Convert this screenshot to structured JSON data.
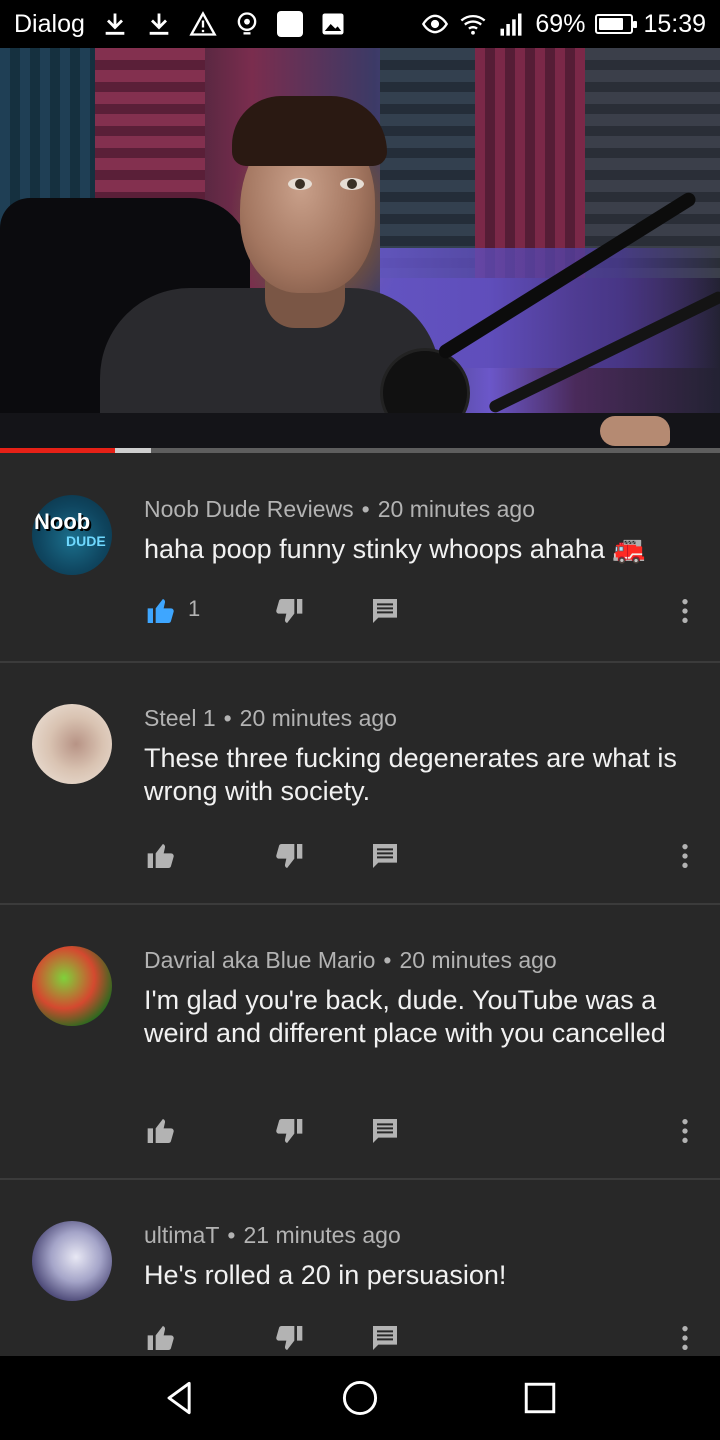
{
  "status_bar": {
    "app_name": "Dialog",
    "battery_percent": "69%",
    "battery_level": 0.69,
    "time": "15:39",
    "icons": [
      "download-icon",
      "download-icon",
      "warning-icon",
      "location-icon",
      "app-square-icon",
      "image-icon",
      "eye-icon",
      "wifi-icon",
      "signal-icon",
      "battery-icon"
    ]
  },
  "video": {
    "played_fraction": 0.16,
    "buffered_fraction": 0.21,
    "progress_color": "#e62117"
  },
  "comments": [
    {
      "author": "Noob Dude Reviews",
      "avatar_text": [
        "Noob",
        "DUDE"
      ],
      "time": "20 minutes ago",
      "text": "haha poop funny stinky whoops ahaha 🚒",
      "like_count": "1",
      "liked": true
    },
    {
      "author": "Steel 1",
      "time": "20 minutes ago",
      "text": "These three fucking degenerates are what is wrong with society.",
      "like_count": "",
      "liked": false
    },
    {
      "author": "Davrial aka Blue Mario",
      "time": "20 minutes ago",
      "text": "I'm glad you're back, dude. YouTube was a weird and different place with you cancelled",
      "like_count": "",
      "liked": false
    },
    {
      "author": "ultimaT",
      "time": "21 minutes ago",
      "text": "He's rolled a 20 in persuasion!",
      "like_count": "",
      "liked": false
    }
  ],
  "colors": {
    "background": "#282828",
    "liked_blue": "#3ea6ff",
    "icon_grey": "#b3b3b3"
  },
  "nav_icons": [
    "back-icon",
    "home-icon",
    "recents-icon"
  ]
}
